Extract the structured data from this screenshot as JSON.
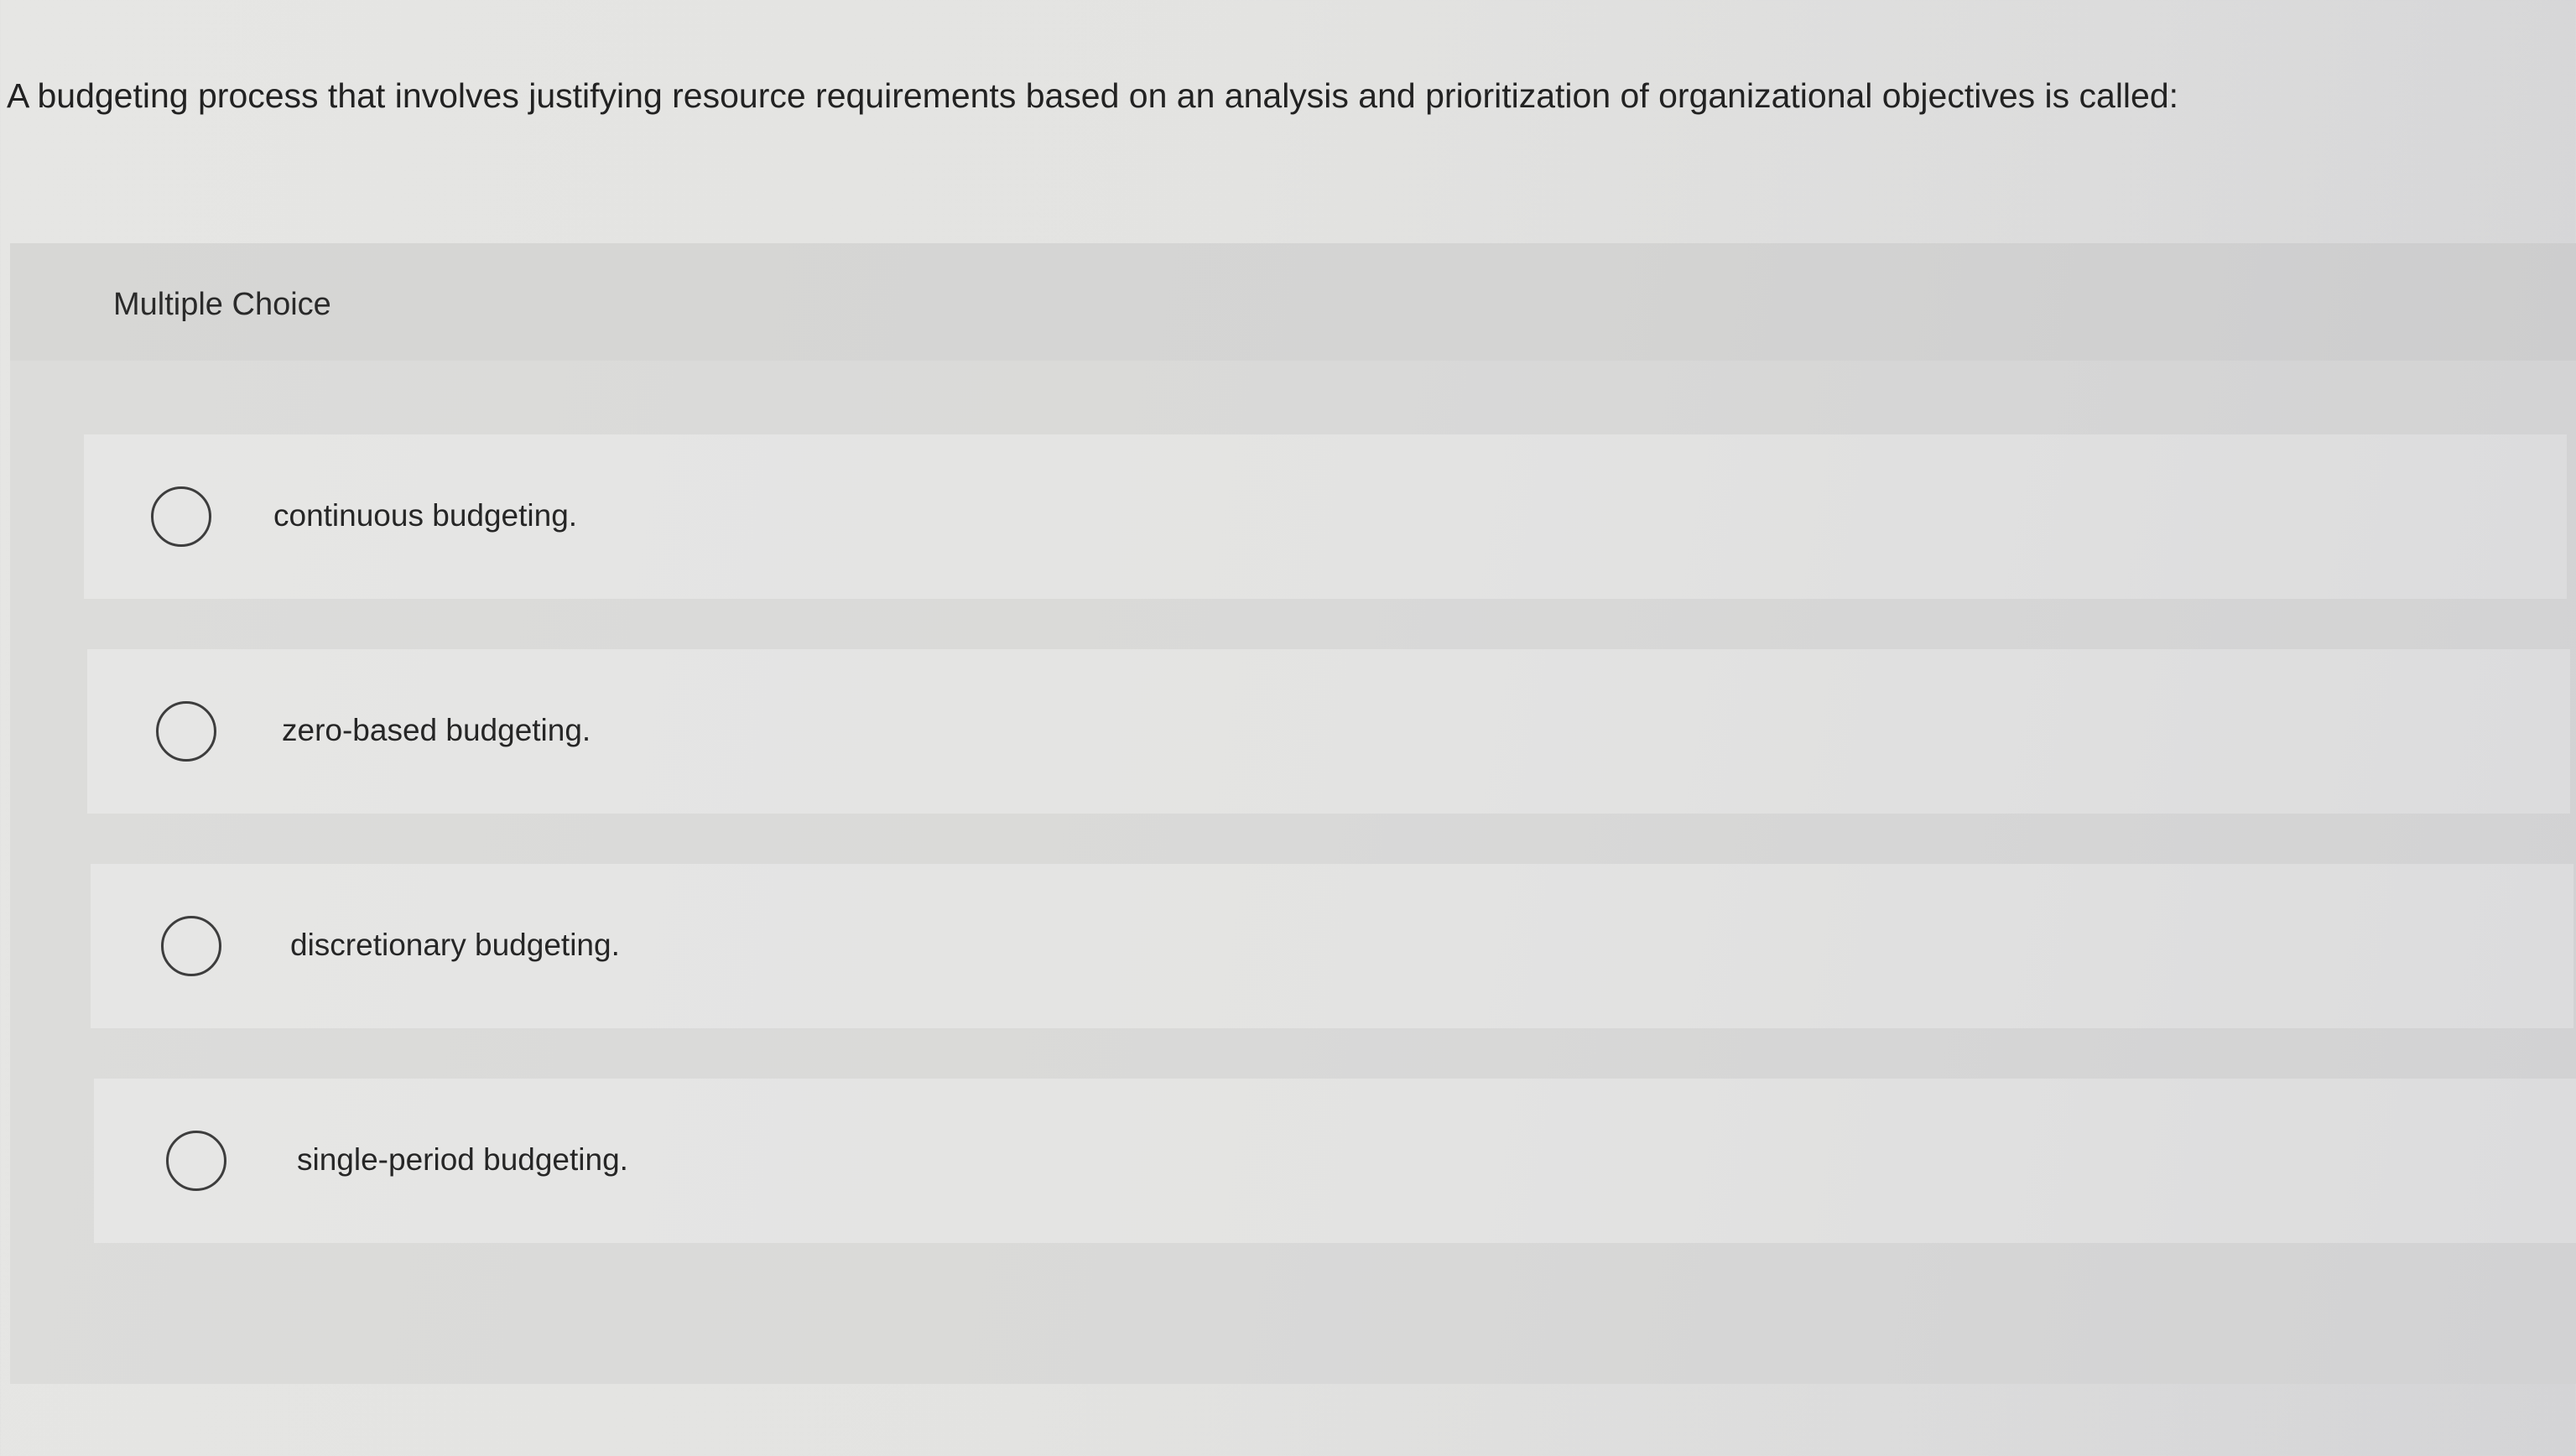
{
  "question": {
    "text": "A budgeting process that involves justifying resource requirements based on an analysis and prioritization of organizational objectives is called:"
  },
  "panel": {
    "title": "Multiple Choice",
    "choices": [
      {
        "label": "continuous budgeting.",
        "selected": false
      },
      {
        "label": "zero-based budgeting.",
        "selected": false
      },
      {
        "label": "discretionary budgeting.",
        "selected": false
      },
      {
        "label": "single-period budgeting.",
        "selected": false
      }
    ]
  }
}
